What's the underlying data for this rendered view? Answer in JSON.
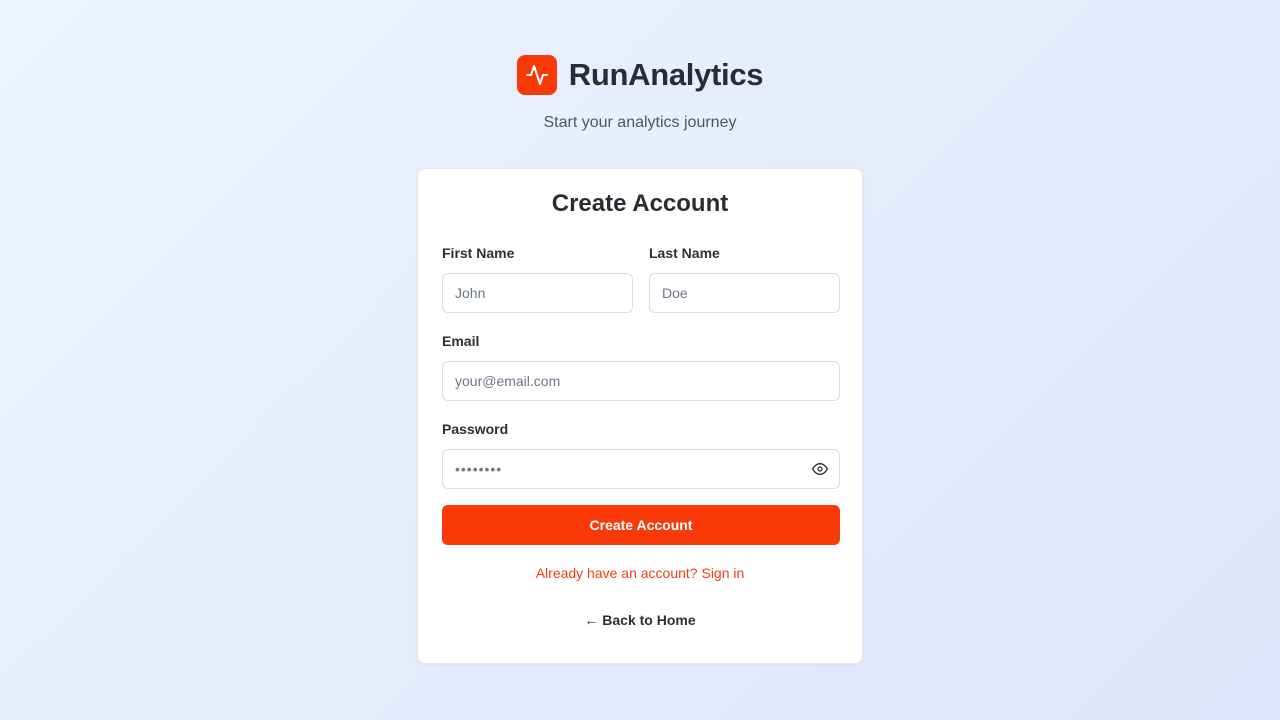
{
  "brand": {
    "name": "RunAnalytics",
    "tagline": "Start your analytics journey",
    "logo_icon": "activity-pulse-icon",
    "accent_color": "#f93a08"
  },
  "form": {
    "title": "Create Account",
    "first_name": {
      "label": "First Name",
      "placeholder": "John",
      "value": ""
    },
    "last_name": {
      "label": "Last Name",
      "placeholder": "Doe",
      "value": ""
    },
    "email": {
      "label": "Email",
      "placeholder": "your@email.com",
      "value": ""
    },
    "password": {
      "label": "Password",
      "placeholder": "••••••••",
      "value": "",
      "toggle_icon": "eye-icon"
    },
    "submit_label": "Create Account",
    "signin_link": "Already have an account? Sign in",
    "back_link": "← Back to Home"
  }
}
